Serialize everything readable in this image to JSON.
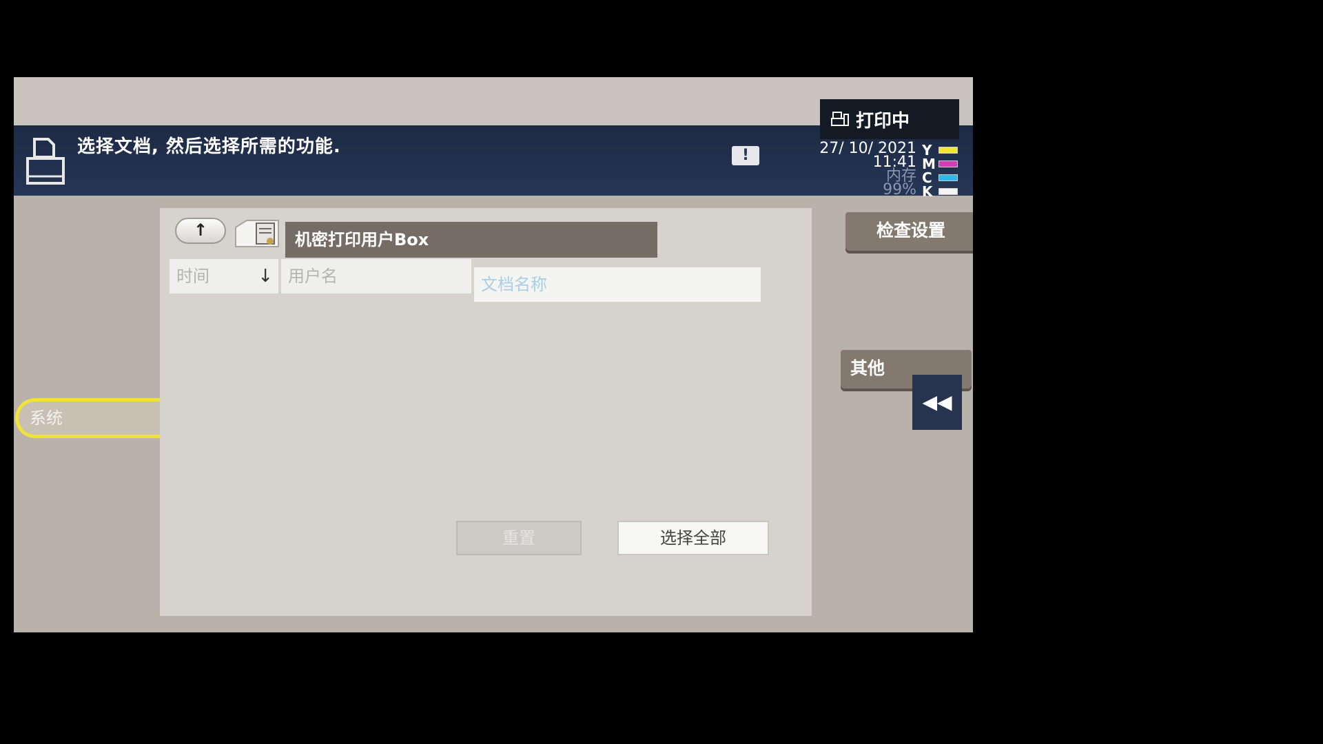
{
  "status": {
    "printing_label": "打印中"
  },
  "message_bar": {
    "text": "选择文档, 然后选择所需的功能.",
    "warning_symbol": "!"
  },
  "datetime": {
    "date": "27/ 10/ 2021",
    "time": "11:41",
    "memory_label": "内存",
    "memory_value": "99%"
  },
  "toner": [
    {
      "letter": "Y",
      "color": "#f2e534"
    },
    {
      "letter": "M",
      "color": "#d23fb4"
    },
    {
      "letter": "C",
      "color": "#2fb6e8"
    },
    {
      "letter": "K",
      "color": "#f4f4f4"
    }
  ],
  "sidebar": {
    "system_label": "系统"
  },
  "panel": {
    "up_symbol": "↑",
    "box_title": "机密打印用户Box",
    "columns": [
      {
        "label": "时间",
        "sort": "↓"
      },
      {
        "label": "用户名"
      },
      {
        "label": "文档名称"
      }
    ],
    "disabled_button_label": "重置",
    "select_all_label": "选择全部"
  },
  "right_panel": {
    "check_settings_label": "检查设置",
    "other_label": "其他",
    "collapse_symbol": "◀◀"
  },
  "colors": {
    "header_bg": "#22314e",
    "highlight_yellow": "#f0e23a",
    "title_bar": "#756c66",
    "side_button": "#83796f"
  }
}
